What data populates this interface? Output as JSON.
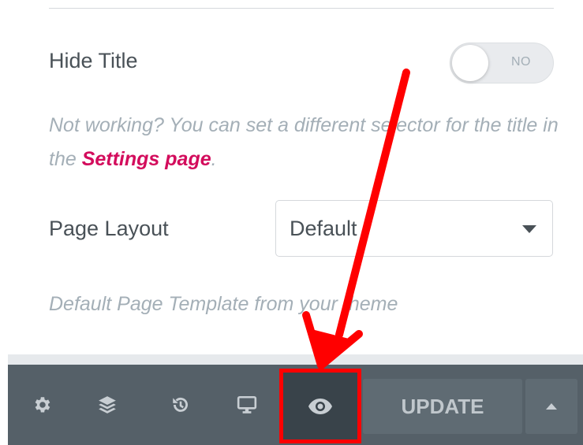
{
  "settings": {
    "hide_title": {
      "label": "Hide Title",
      "toggle_state": "NO"
    },
    "help": {
      "text_before": "Not working? You can set a different selector for the title in the ",
      "link_text": "Settings page",
      "text_after": "."
    },
    "page_layout": {
      "label": "Page Layout",
      "selected": "Default",
      "description": "Default Page Template from your theme"
    }
  },
  "footer": {
    "icons": [
      "gear-icon",
      "layers-icon",
      "history-icon",
      "desktop-icon",
      "eye-icon"
    ],
    "update_label": "UPDATE",
    "more_icon": "caret-up-icon"
  },
  "colors": {
    "text": "#495157",
    "muted": "#a4afb7",
    "link": "#d30c5c",
    "footer_bg": "#556068",
    "highlight": "#ff0000"
  }
}
